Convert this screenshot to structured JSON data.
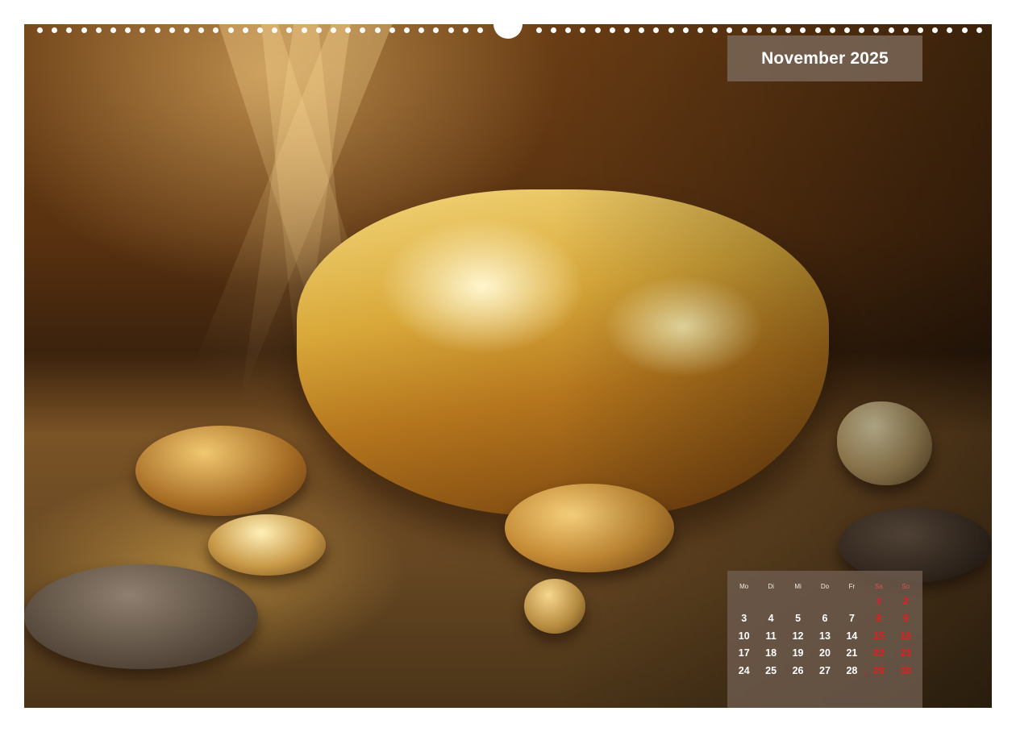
{
  "calendar_page": {
    "title": "November 2025",
    "weekdays": [
      "Mo",
      "Di",
      "Mi",
      "Do",
      "Fr",
      "Sa",
      "So"
    ],
    "weekend_color": "#e02020",
    "weeks": [
      [
        "",
        "",
        "",
        "",
        "",
        "1",
        "2"
      ],
      [
        "3",
        "4",
        "5",
        "6",
        "7",
        "8",
        "9"
      ],
      [
        "10",
        "11",
        "12",
        "13",
        "14",
        "15",
        "16"
      ],
      [
        "17",
        "18",
        "19",
        "20",
        "21",
        "22",
        "23"
      ],
      [
        "24",
        "25",
        "26",
        "27",
        "28",
        "29",
        "30"
      ]
    ]
  }
}
